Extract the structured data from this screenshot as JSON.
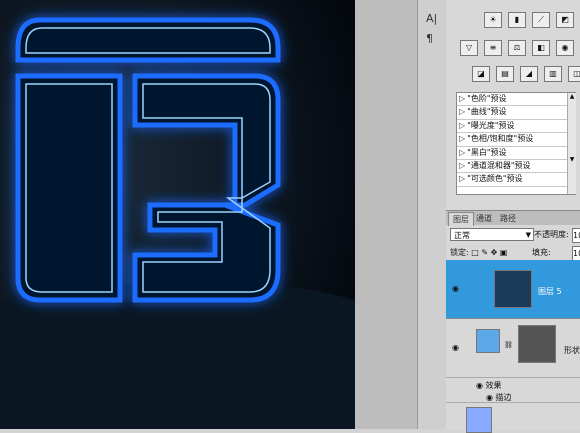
{
  "canvas": {
    "logo_glow_color": "#1a6cff",
    "logo_core_color": "#9cd2ff",
    "background_color": "#050b14"
  },
  "toolstrip": {
    "char_icon": "A|",
    "para_icon": "¶"
  },
  "adjustments": {
    "row1": [
      "brightness-icon",
      "levels-icon",
      "curves-icon",
      "exposure-icon"
    ],
    "row2": [
      "vibrance-icon",
      "hue-icon",
      "color-balance-icon",
      "bw-icon",
      "photo-filter-icon",
      "channel-mixer-icon"
    ],
    "row3": [
      "invert-icon",
      "posterize-icon",
      "threshold-icon",
      "gradient-map-icon",
      "selective-color-icon"
    ]
  },
  "presets": [
    "\"色阶\"预设",
    "\"曲线\"预设",
    "\"曝光度\"预设",
    "\"色相/饱和度\"预设",
    "\"黑白\"预设",
    "\"通道混和器\"预设",
    "\"可选颜色\"预设"
  ],
  "layers_panel": {
    "tabs": [
      "图层",
      "通道",
      "路径"
    ],
    "blend_mode": "正常",
    "opacity_label": "不透明度:",
    "opacity_value": "10",
    "lock_label": "锁定:",
    "fill_label": "填充:",
    "fill_value": "10",
    "layers": [
      {
        "name": "图层 5",
        "selected": true
      },
      {
        "name": "形状",
        "selected": false
      }
    ],
    "effects_label": "效果",
    "stroke_label": "描边"
  }
}
